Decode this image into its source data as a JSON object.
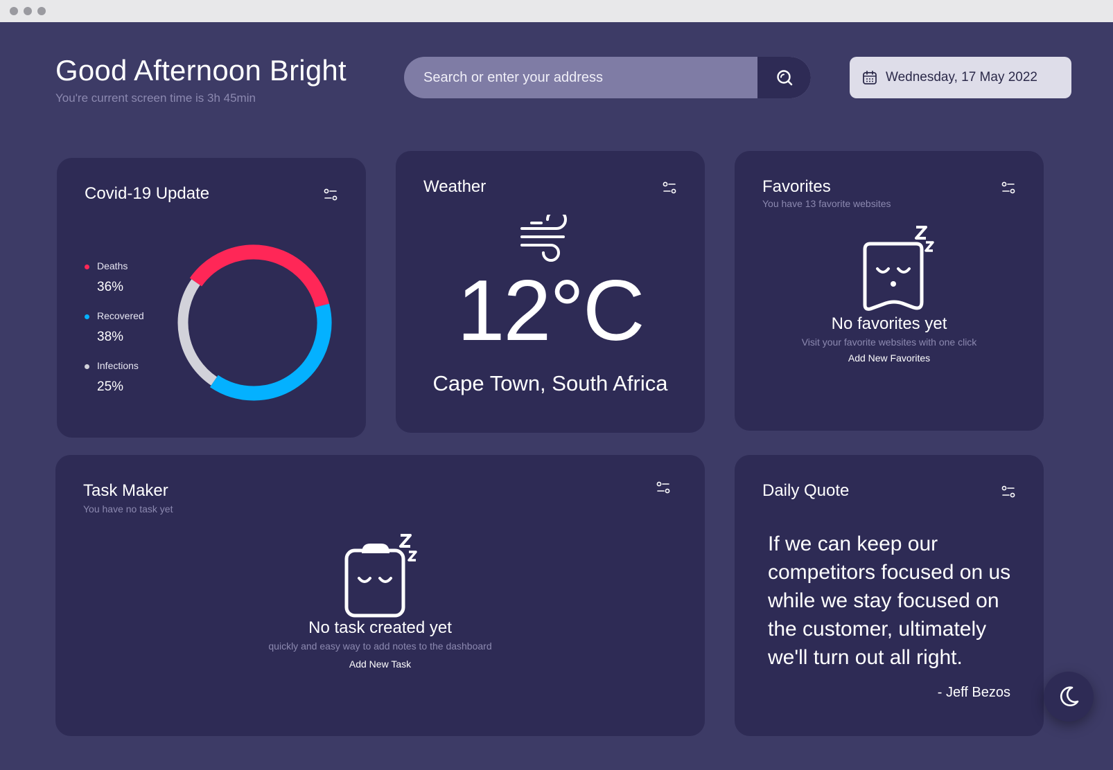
{
  "header": {
    "greeting": "Good Afternoon Bright",
    "screen_time": "You're current screen time is  3h 45min"
  },
  "search": {
    "placeholder": "Search or enter your address",
    "icon": "search-icon"
  },
  "date": {
    "label": "Wednesday, 17 May 2022",
    "icon": "calendar-icon"
  },
  "covid": {
    "title": "Covid-19 Update",
    "items": [
      {
        "label": "Deaths",
        "value": "36%",
        "color": "#ff2757"
      },
      {
        "label": "Recovered",
        "value": "38%",
        "color": "#04b1ff"
      },
      {
        "label": "Infections",
        "value": "25%",
        "color": "#d2d2da"
      }
    ],
    "chart_data": {
      "type": "pie",
      "labels": [
        "Deaths",
        "Recovered",
        "Infections"
      ],
      "values": [
        36,
        38,
        25
      ],
      "colors": [
        "#ff2757",
        "#04b1ff",
        "#d2d2da"
      ]
    }
  },
  "weather": {
    "title": "Weather",
    "temperature": "12°C",
    "location": "Cape Town, South Africa",
    "icon": "wind-icon"
  },
  "favorites": {
    "title": "Favorites",
    "subtitle": "You have 13 favorite websites",
    "empty_title": "No favorites yet",
    "empty_subtitle": "Visit your favorite websites with one click",
    "add_label": "Add New Favorites",
    "icon": "sleeping-page-icon"
  },
  "tasks": {
    "title": "Task Maker",
    "subtitle": "You have no task yet",
    "empty_title": "No task created yet",
    "empty_subtitle": "quickly and easy way to add notes to the dashboard",
    "add_label": "Add New Task",
    "icon": "sleeping-clipboard-icon"
  },
  "quote": {
    "title": "Daily Quote",
    "text": "If we can keep our competitors focused on us while we stay focused on the customer, ultimately we'll turn out all right.",
    "author": "- Jeff Bezos"
  },
  "theme_toggle": {
    "icon": "moon-icon"
  },
  "colors": {
    "background": "#3d3b66",
    "card": "#2e2b55",
    "muted_text": "#8c89b0",
    "search_bg": "#7f7ca5",
    "date_bg": "#dedde9"
  }
}
